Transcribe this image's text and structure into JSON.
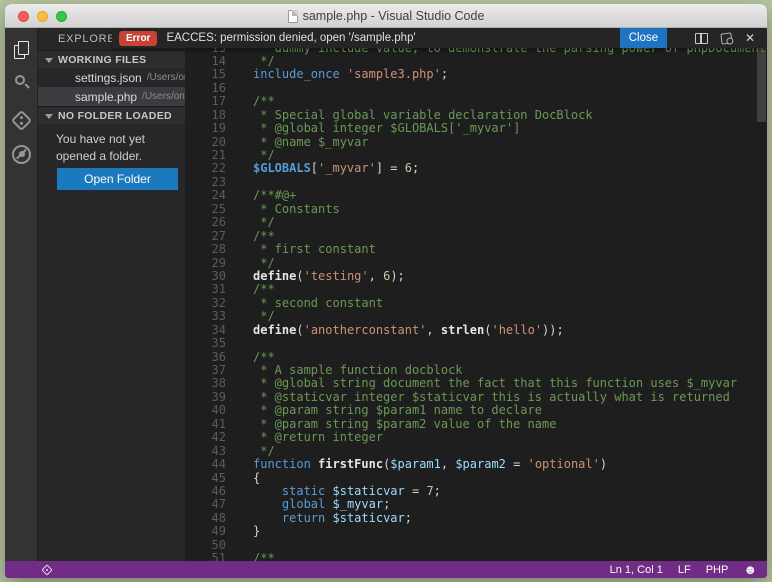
{
  "window": {
    "title": "sample.php - Visual Studio Code"
  },
  "notification": {
    "badge": "Error",
    "message": "EACCES: permission denied, open '/sample.php'",
    "close_label": "Close"
  },
  "activity_bar": {
    "icons": [
      "files-explorer",
      "search",
      "git",
      "debug-disabled"
    ]
  },
  "sidebar": {
    "title": "EXPLORE",
    "working_files": {
      "label": "WORKING FILES",
      "files": [
        {
          "name": "settings.json",
          "path": "/Users/ontecnia...",
          "selected": false
        },
        {
          "name": "sample.php",
          "path": "/Users/ontecnia/...",
          "selected": true
        }
      ]
    },
    "no_folder": {
      "label": "NO FOLDER LOADED",
      "message": "You have not yet opened a folder.",
      "button": "Open Folder"
    }
  },
  "editor": {
    "language": "php",
    "first_line_number": 13,
    "lines": [
      [
        [
          " * dummy include value, to demonstrate the parsing power of phpDocumentor",
          "cm"
        ]
      ],
      [
        [
          " */",
          "cm"
        ]
      ],
      [
        [
          "include_once",
          "kw"
        ],
        [
          " ",
          "pl"
        ],
        [
          "'sample3.php'",
          "st"
        ],
        [
          ";",
          "pl"
        ]
      ],
      [],
      [
        [
          "/**",
          "cm"
        ]
      ],
      [
        [
          " * Special global variable declaration DocBlock",
          "cm"
        ]
      ],
      [
        [
          " * @global integer $GLOBALS['_myvar']",
          "cm"
        ]
      ],
      [
        [
          " * @name $_myvar",
          "cm"
        ]
      ],
      [
        [
          " */",
          "cm"
        ]
      ],
      [
        [
          "$GLOBALS",
          "kwb"
        ],
        [
          "[",
          "pl"
        ],
        [
          "'_myvar'",
          "st"
        ],
        [
          "] = ",
          "pl"
        ],
        [
          "6",
          "nm"
        ],
        [
          ";",
          "pl"
        ]
      ],
      [],
      [
        [
          "/**#@+",
          "cm"
        ]
      ],
      [
        [
          " * Constants",
          "cm"
        ]
      ],
      [
        [
          " */",
          "cm"
        ]
      ],
      [
        [
          "/**",
          "cm"
        ]
      ],
      [
        [
          " * first constant",
          "cm"
        ]
      ],
      [
        [
          " */",
          "cm"
        ]
      ],
      [
        [
          "define",
          "fn"
        ],
        [
          "(",
          "pl"
        ],
        [
          "'testing'",
          "st"
        ],
        [
          ", ",
          "pl"
        ],
        [
          "6",
          "nm"
        ],
        [
          ");",
          "pl"
        ]
      ],
      [
        [
          "/**",
          "cm"
        ]
      ],
      [
        [
          " * second constant",
          "cm"
        ]
      ],
      [
        [
          " */",
          "cm"
        ]
      ],
      [
        [
          "define",
          "fn"
        ],
        [
          "(",
          "pl"
        ],
        [
          "'anotherconstant'",
          "st"
        ],
        [
          ", ",
          "pl"
        ],
        [
          "strlen",
          "fn"
        ],
        [
          "(",
          "pl"
        ],
        [
          "'hello'",
          "st"
        ],
        [
          "));",
          "pl"
        ]
      ],
      [],
      [
        [
          "/**",
          "cm"
        ]
      ],
      [
        [
          " * A sample function docblock",
          "cm"
        ]
      ],
      [
        [
          " * @global string document the fact that this function uses $_myvar",
          "cm"
        ]
      ],
      [
        [
          " * @staticvar integer $staticvar this is actually what is returned",
          "cm"
        ]
      ],
      [
        [
          " * @param string $param1 name to declare",
          "cm"
        ]
      ],
      [
        [
          " * @param string $param2 value of the name",
          "cm"
        ]
      ],
      [
        [
          " * @return integer",
          "cm"
        ]
      ],
      [
        [
          " */",
          "cm"
        ]
      ],
      [
        [
          "function",
          "kw"
        ],
        [
          " ",
          "pl"
        ],
        [
          "firstFunc",
          "fn"
        ],
        [
          "(",
          "pl"
        ],
        [
          "$param1",
          "vr"
        ],
        [
          ", ",
          "pl"
        ],
        [
          "$param2",
          "vr"
        ],
        [
          " = ",
          "pl"
        ],
        [
          "'optional'",
          "st"
        ],
        [
          ")",
          "pl"
        ]
      ],
      [
        [
          "{",
          "pl"
        ]
      ],
      [
        [
          "    ",
          "pl"
        ],
        [
          "static",
          "kw"
        ],
        [
          " ",
          "pl"
        ],
        [
          "$staticvar",
          "vr"
        ],
        [
          " = ",
          "pl"
        ],
        [
          "7",
          "nm"
        ],
        [
          ";",
          "pl"
        ]
      ],
      [
        [
          "    ",
          "pl"
        ],
        [
          "global",
          "kw"
        ],
        [
          " ",
          "pl"
        ],
        [
          "$_myvar",
          "vr"
        ],
        [
          ";",
          "pl"
        ]
      ],
      [
        [
          "    ",
          "pl"
        ],
        [
          "return",
          "kw"
        ],
        [
          " ",
          "pl"
        ],
        [
          "$staticvar",
          "vr"
        ],
        [
          ";",
          "pl"
        ]
      ],
      [
        [
          "}",
          "pl"
        ]
      ],
      [],
      [
        [
          "/**",
          "cm"
        ]
      ]
    ]
  },
  "status_bar": {
    "cursor_position": "Ln 1, Col 1",
    "eol": "LF",
    "language_mode": "PHP",
    "smiley": "☻"
  },
  "colors": {
    "desktop": "#b6c5a0",
    "editor_bg": "#1e1e1e",
    "sidebar_bg": "#272729",
    "activity_bar_bg": "#333333",
    "status_bar_bg": "#712d85",
    "error_badge": "#c74334",
    "accent_blue": "#1b79bd",
    "close_button": "#1e73c2"
  }
}
